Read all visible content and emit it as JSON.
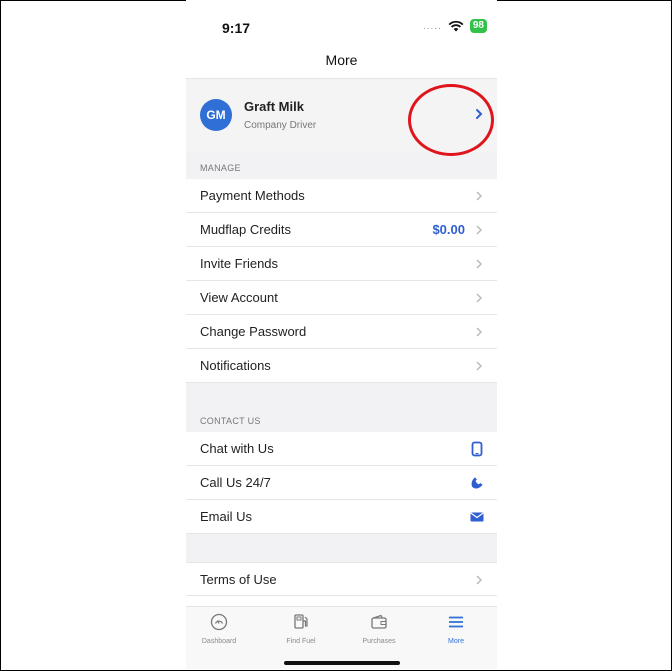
{
  "status": {
    "time": "9:17",
    "signal": ".....",
    "battery": "98"
  },
  "navbar": {
    "title": "More"
  },
  "profile": {
    "initials": "GM",
    "name": "Graft Milk",
    "role": "Company Driver"
  },
  "manage": {
    "header": "MANAGE",
    "items": [
      {
        "label": "Payment Methods"
      },
      {
        "label": "Mudflap Credits",
        "value": "$0.00"
      },
      {
        "label": "Invite Friends"
      },
      {
        "label": "View Account"
      },
      {
        "label": "Change Password"
      },
      {
        "label": "Notifications"
      }
    ]
  },
  "contact": {
    "header": "CONTACT US",
    "items": [
      {
        "label": "Chat with Us",
        "icon": "phone-device-icon"
      },
      {
        "label": "Call Us 24/7",
        "icon": "phone-call-icon"
      },
      {
        "label": "Email Us",
        "icon": "envelope-icon"
      }
    ]
  },
  "legal": {
    "items": [
      {
        "label": "Terms of Use"
      }
    ]
  },
  "tabs": [
    {
      "label": "Dashboard",
      "icon": "dashboard-gauge-icon"
    },
    {
      "label": "Find Fuel",
      "icon": "fuel-pump-icon"
    },
    {
      "label": "Purchases",
      "icon": "wallet-icon"
    },
    {
      "label": "More",
      "icon": "menu-icon",
      "active": true
    }
  ],
  "colors": {
    "accent": "#2f6fd6",
    "annotation": "#e0141b",
    "battery": "#31c24a"
  }
}
